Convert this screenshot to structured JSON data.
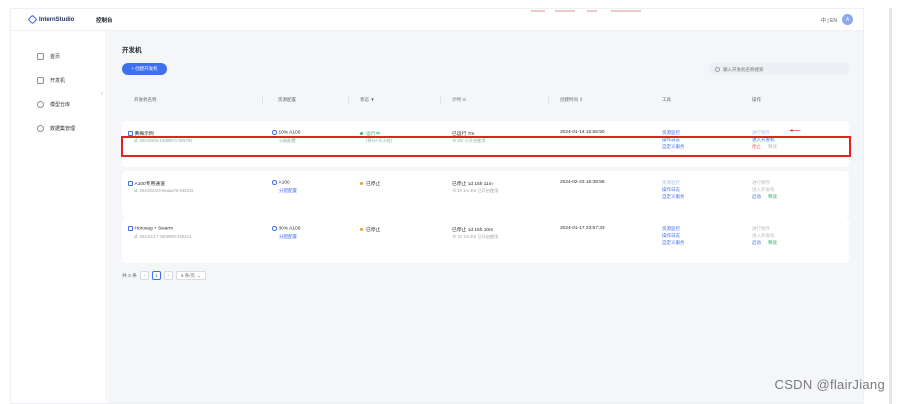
{
  "topbar": {
    "logo_text": "InternStudio",
    "nav_title": "控制台",
    "lang": "中 | EN",
    "avatar_letter": "A"
  },
  "sidebar": {
    "items": [
      {
        "label": "首页",
        "icon": "home-icon"
      },
      {
        "label": "开发机",
        "icon": "devbox-icon"
      },
      {
        "label": "模型仓库",
        "icon": "model-icon"
      },
      {
        "label": "数据集管理",
        "icon": "dataset-icon"
      }
    ]
  },
  "main": {
    "title": "开发机",
    "create_label": "+ 创建开发机",
    "search_placeholder": "输入开发机名称搜索"
  },
  "table": {
    "headers": [
      "开发机名称",
      "资源配置",
      "状态 ▼",
      "计时 ⊙",
      "创建时间 ⇕",
      "工具",
      "操作"
    ],
    "rows": [
      {
        "name": "黄梅示例",
        "id": "id: 2024/0/04-15d8f871-925792",
        "gpu": "10% A100",
        "gpu_sub": "分配配置",
        "status": "运行中",
        "status_sub": "(预计7天小时)",
        "timer": "已运行 7m",
        "timer_sub": "节 2hr 已开启使用",
        "created": "2024-01-14 15:56:50",
        "tools": [
          "资源监控",
          "操作日志",
          "自定义服务"
        ],
        "ops": [
          "进行保存",
          "进入开发机",
          "停止",
          "释放"
        ]
      },
      {
        "name": "A100专用通道",
        "id": "id: 2024/02/23-9aaaa79-635232",
        "gpu": "A100",
        "gpu_sub": "分配配置",
        "status": "已停止",
        "status_sub": "",
        "timer": "已停止 1d 15h 11m",
        "timer_sub": "节 1h 1m 4hr 已开启使用",
        "created": "2024-02-23 15:38:56",
        "tools": [
          "资源监控",
          "操作日志",
          "自定义服务"
        ],
        "ops": [
          "进行保存",
          "进入开发机",
          "启动",
          "释放"
        ]
      },
      {
        "name": "Horovag + Swarm",
        "id": "id: 2024/1/17-3a09080-425212",
        "gpu": "30% A100",
        "gpu_sub": "分配配置",
        "status": "已停止",
        "status_sub": "",
        "timer": "已停止 1d 15h 10m",
        "timer_sub": "节 1h 1m 4hr 已开启使用",
        "created": "2024-01-17 23:57:33",
        "tools": [
          "资源监控",
          "操作日志",
          "自定义服务"
        ],
        "ops": [
          "进行保存",
          "进入开发机",
          "启动",
          "释放"
        ]
      }
    ]
  },
  "pager": {
    "total": "共 3 条",
    "current_page": "1",
    "page_size": "5 条/页"
  },
  "watermark": "CSDN @flairJiang",
  "colors": {
    "accent": "#3f6ef0",
    "highlight": "#e0231c",
    "running": "#3cb371",
    "stopped": "#f0a020"
  }
}
